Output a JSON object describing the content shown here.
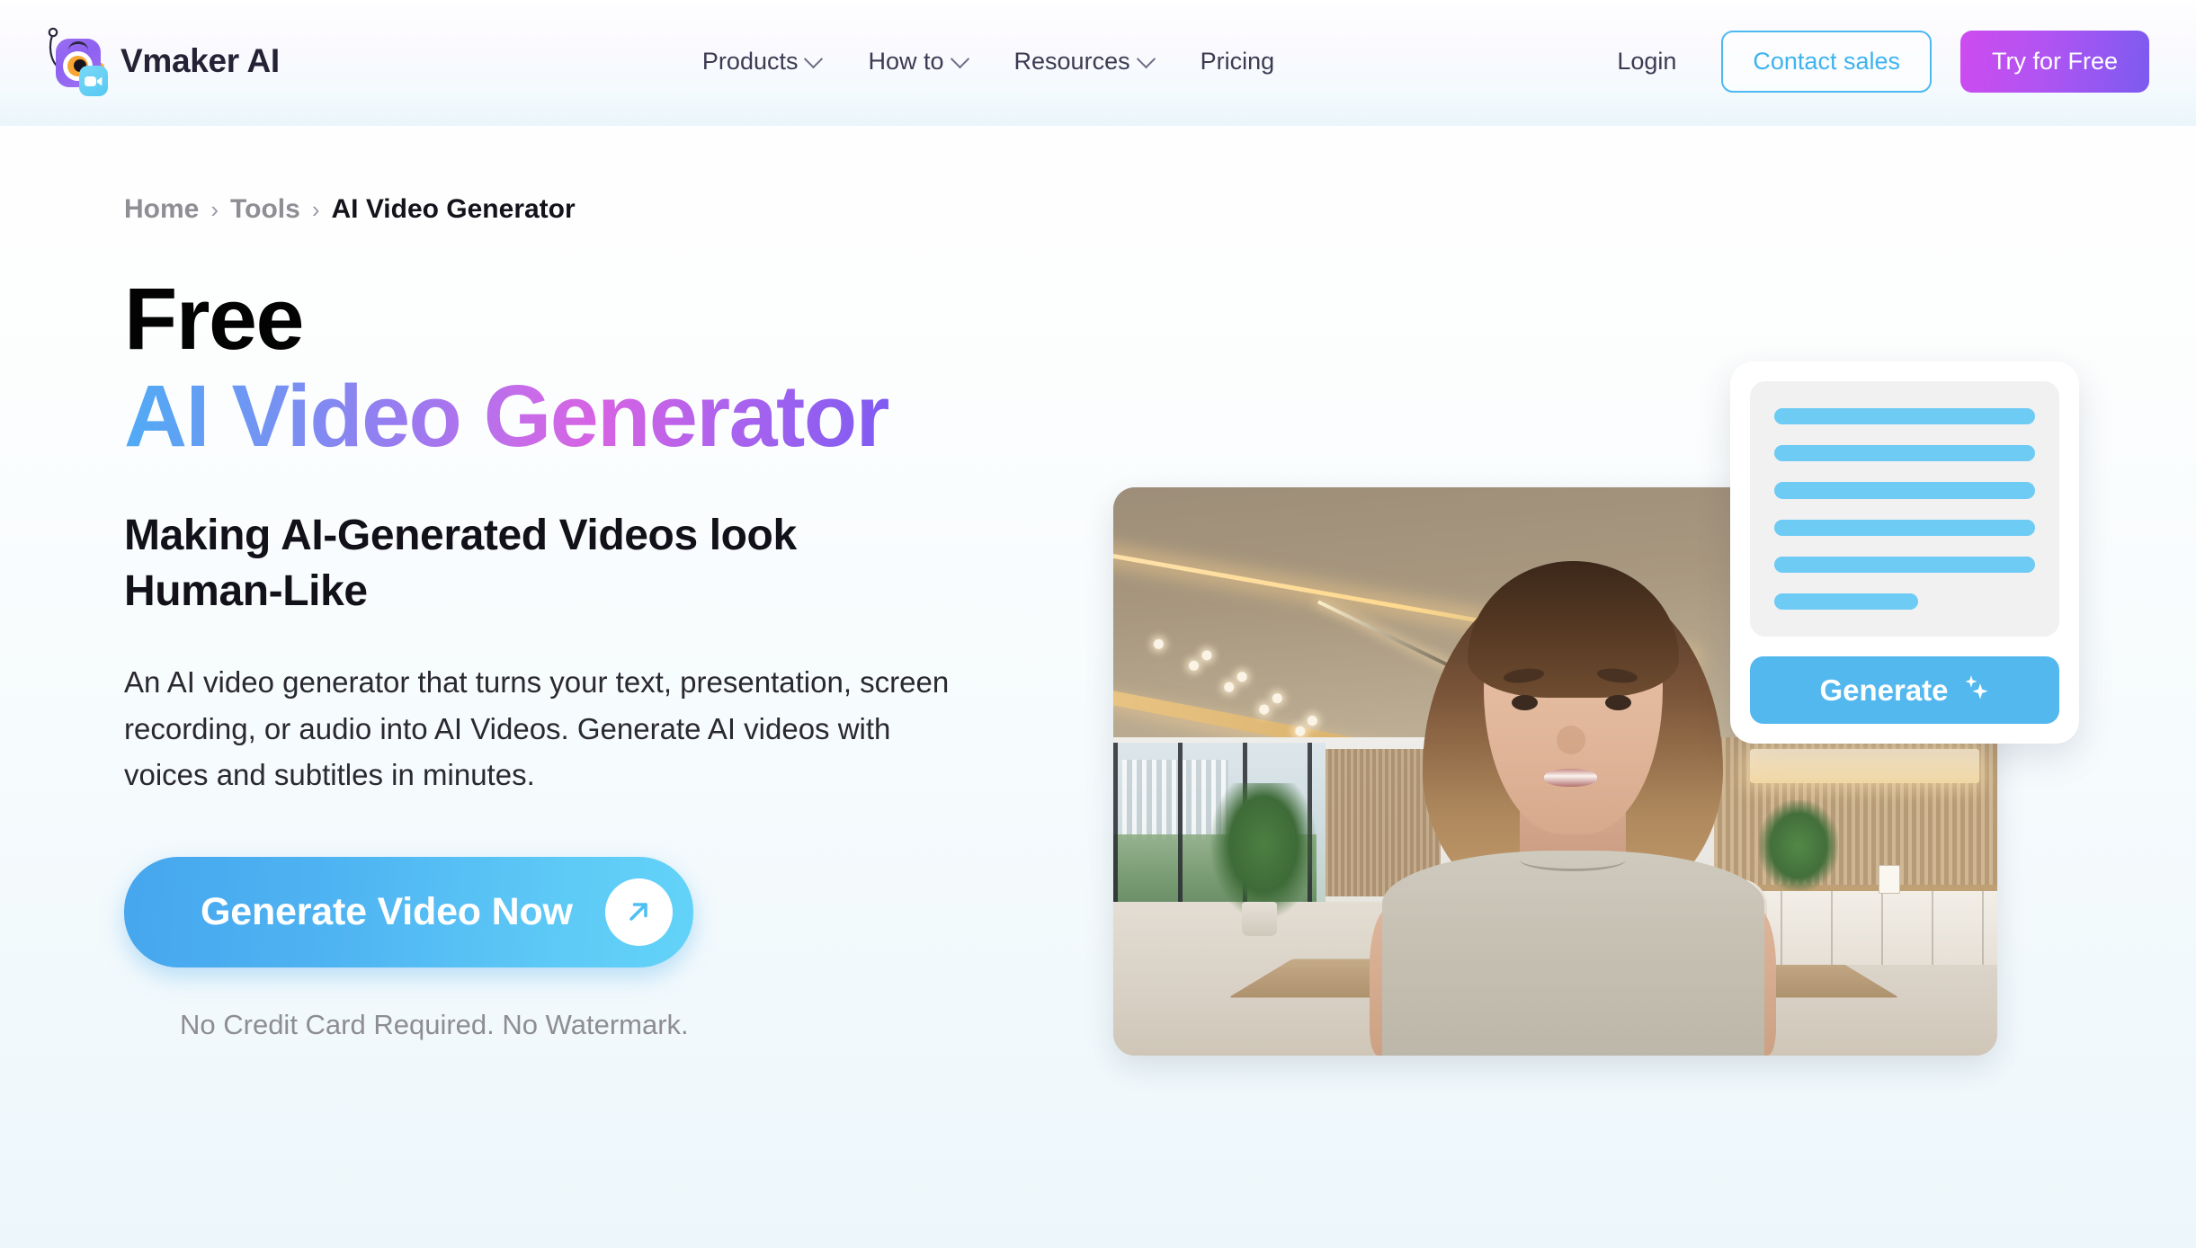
{
  "header": {
    "brand_name": "Vmaker AI",
    "logo_icon": "vmaker-eye-camera-logo",
    "nav": [
      {
        "label": "Products",
        "has_dropdown": true
      },
      {
        "label": "How to",
        "has_dropdown": true
      },
      {
        "label": "Resources",
        "has_dropdown": true
      },
      {
        "label": "Pricing",
        "has_dropdown": false
      }
    ],
    "login_label": "Login",
    "contact_sales_label": "Contact sales",
    "try_free_label": "Try for Free",
    "colors": {
      "contact_border": "#4CB9F2",
      "try_gradient_start": "#CE4BEF",
      "try_gradient_end": "#7B5BF0"
    }
  },
  "breadcrumb": {
    "separator": "›",
    "items": [
      {
        "label": "Home",
        "current": false
      },
      {
        "label": "Tools",
        "current": false
      },
      {
        "label": "AI Video Generator",
        "current": true
      }
    ]
  },
  "hero": {
    "title_line1": "Free",
    "title_line2": "AI Video Generator",
    "title_gradient_start": "#4FACF5",
    "title_gradient_mid": "#D763E3",
    "title_gradient_end": "#7E5BF2",
    "subtitle": "Making AI-Generated Videos look Human-Like",
    "description": "An AI video generator that turns your text, presentation, screen recording, or audio into AI Videos. Generate AI videos with voices and subtitles in minutes.",
    "cta_label": "Generate Video Now",
    "cta_icon": "arrow-up-right-icon",
    "cta_note": "No Credit Card Required. No Watermark.",
    "cta_gradient_start": "#46A6EE",
    "cta_gradient_end": "#63D3F8"
  },
  "media": {
    "video_preview_alt": "AI generated presenter woman in modern office",
    "generate_card": {
      "skeleton_bars": [
        100,
        100,
        100,
        100,
        100,
        55
      ],
      "skeleton_color": "#6DCBF4",
      "button_label": "Generate",
      "button_icon": "sparkle-icon",
      "button_color": "#53B8EE"
    }
  }
}
